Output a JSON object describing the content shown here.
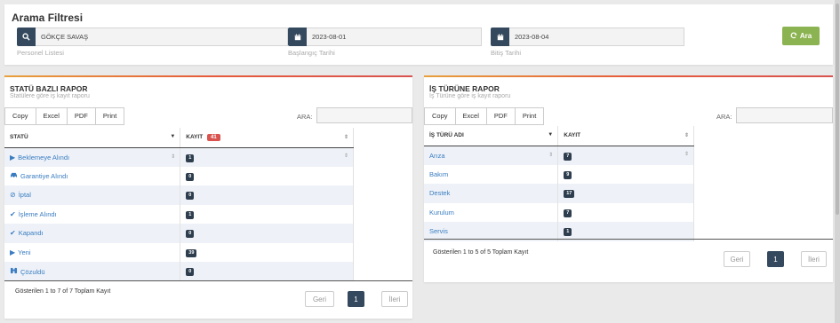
{
  "filter": {
    "title": "Arama Filtresi",
    "personel": {
      "value": "GÖKÇE SAVAŞ",
      "label": "Personel Listesi"
    },
    "start": {
      "value": "2023-08-01",
      "label": "Başlangıç Tarihi"
    },
    "end": {
      "value": "2023-08-04",
      "label": "Bitiş Tarihi"
    },
    "search_button": "Ara",
    "accent_color": "#8cb351"
  },
  "statu_report": {
    "title": "STATÜ BAZLI RAPOR",
    "subtitle": "Statülere göre iş kayıt raporu",
    "buttons": [
      "Copy",
      "Excel",
      "PDF",
      "Print"
    ],
    "search_label": "ARA:",
    "headers": {
      "col1": "STATÜ",
      "col2": "KAYIT",
      "total": "41"
    },
    "rows": [
      {
        "icon": "play-icon",
        "label": "Beklemeye Alındı",
        "count": "1"
      },
      {
        "icon": "car-icon",
        "label": "Garantiye Alındı",
        "count": "0"
      },
      {
        "icon": "ban-icon",
        "label": "İptal",
        "count": "0"
      },
      {
        "icon": "check-icon",
        "label": "İşleme Alındı",
        "count": "1"
      },
      {
        "icon": "check-icon",
        "label": "Kapandı",
        "count": "0"
      },
      {
        "icon": "play-icon",
        "label": "Yeni",
        "count": "39"
      },
      {
        "icon": "binoculars-icon",
        "label": "Çözuldü",
        "count": "0"
      }
    ],
    "info": "Gösterilen 1 to 7 of 7 Toplam Kayıt",
    "pagination": {
      "prev": "Geri",
      "page": "1",
      "next": "İleri"
    }
  },
  "isturu_report": {
    "title": "İŞ TÜRÜNE RAPOR",
    "subtitle": "İş Türüne göre iş kayıt raporu",
    "buttons": [
      "Copy",
      "Excel",
      "PDF",
      "Print"
    ],
    "search_label": "ARA:",
    "headers": {
      "col1": "İŞ TÜRÜ ADI",
      "col2": "KAYIT"
    },
    "rows": [
      {
        "label": "Arıza",
        "count": "7"
      },
      {
        "label": "Bakım",
        "count": "9"
      },
      {
        "label": "Destek",
        "count": "17"
      },
      {
        "label": "Kurulum",
        "count": "7"
      },
      {
        "label": "Servis",
        "count": "1"
      }
    ],
    "info": "Gösterilen 1 to 5 of 5 Toplam Kayıt",
    "pagination": {
      "prev": "Geri",
      "page": "1",
      "next": "İleri"
    }
  }
}
